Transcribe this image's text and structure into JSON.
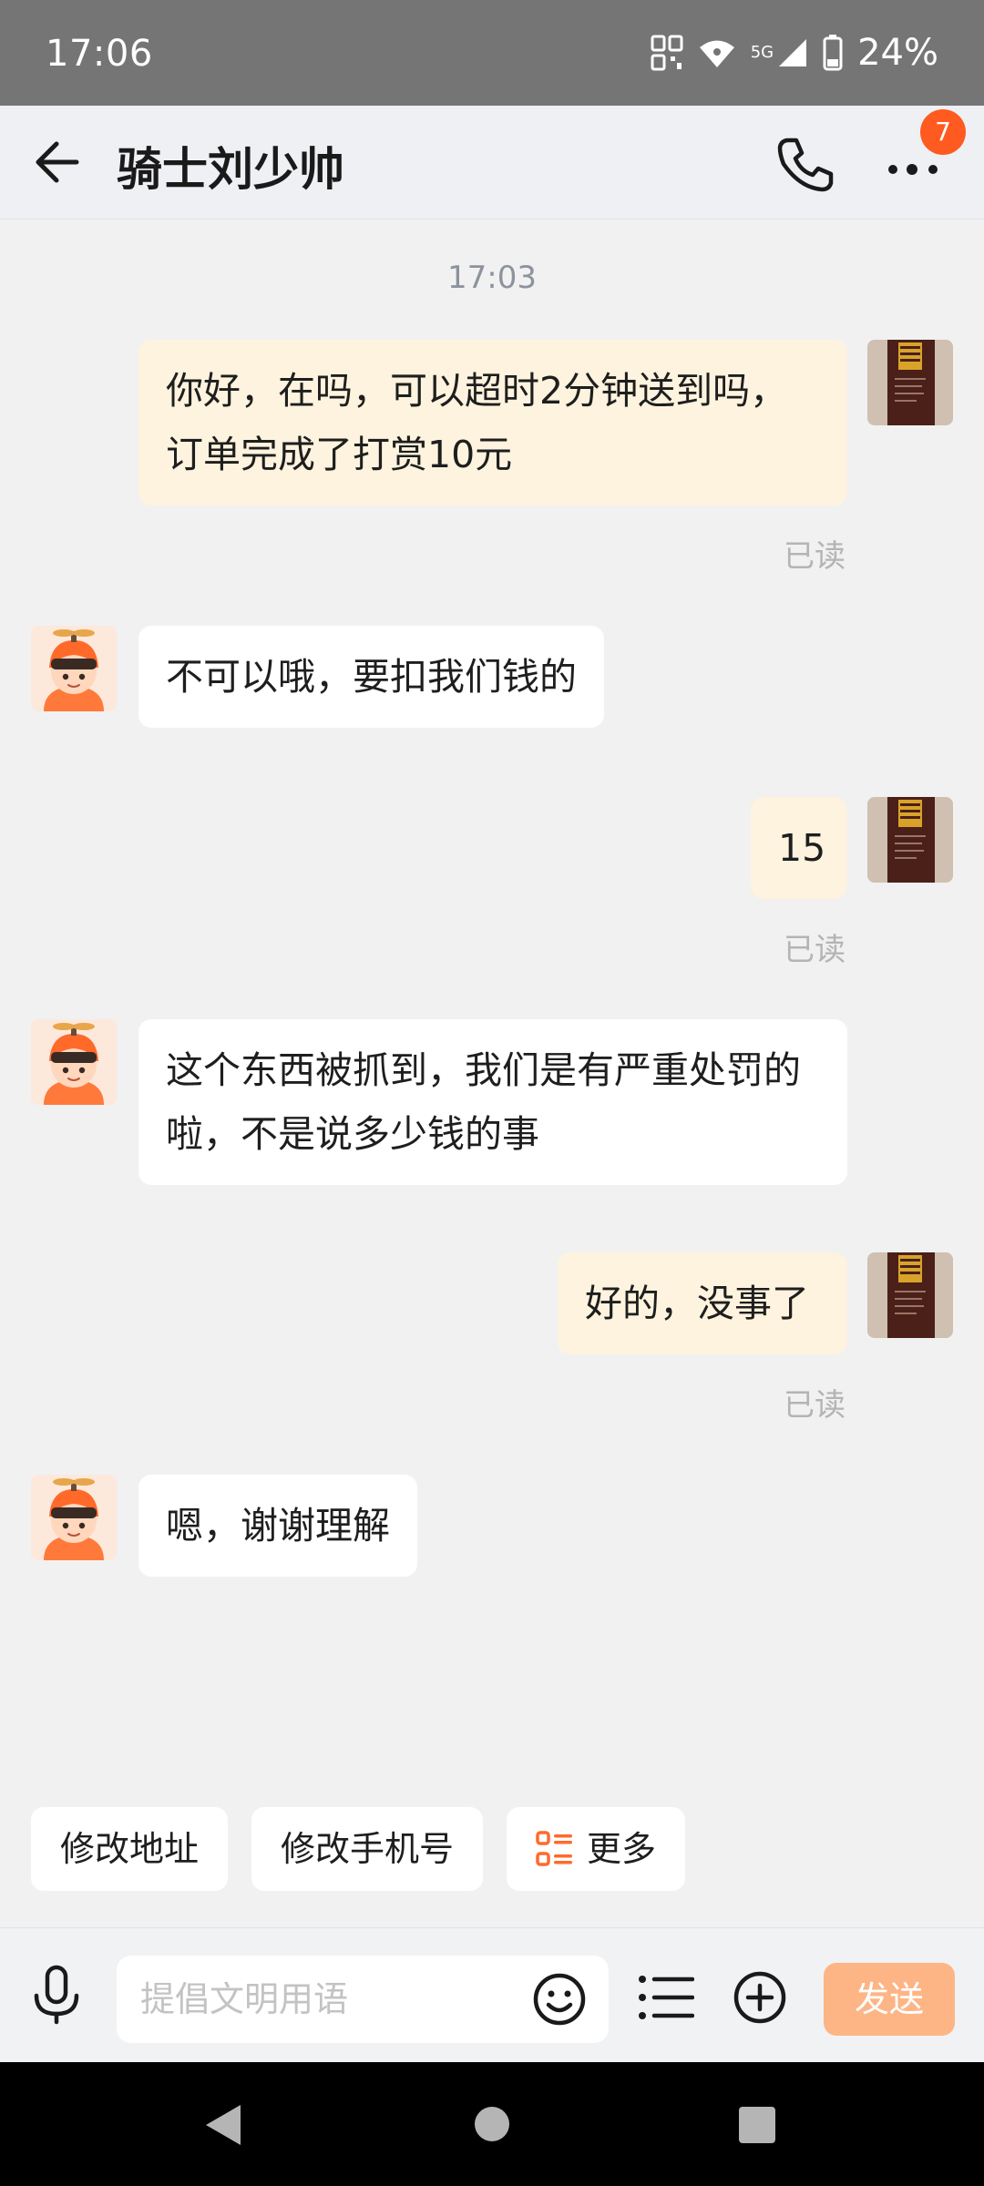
{
  "status_bar": {
    "time": "17:06",
    "network": "5G",
    "battery": "24%"
  },
  "header": {
    "title": "骑士刘少帅",
    "badge_count": "7"
  },
  "chat": {
    "timestamp": "17:03",
    "messages": [
      {
        "from": "me",
        "text": "你好，在吗，可以超时2分钟送到吗，订单完成了打赏10元",
        "status": "已读"
      },
      {
        "from": "rider",
        "text": "不可以哦，要扣我们钱的"
      },
      {
        "from": "me",
        "text": "15",
        "status": "已读"
      },
      {
        "from": "rider",
        "text": "这个东西被抓到，我们是有严重处罚的啦，不是说多少钱的事"
      },
      {
        "from": "me",
        "text": "好的，没事了",
        "status": "已读"
      },
      {
        "from": "rider",
        "text": "嗯，谢谢理解"
      }
    ]
  },
  "quick_actions": [
    {
      "label": "修改地址"
    },
    {
      "label": "修改手机号"
    },
    {
      "label": "更多",
      "icon": "list-icon"
    }
  ],
  "input": {
    "placeholder": "提倡文明用语",
    "value": "",
    "send_label": "发送"
  },
  "colors": {
    "accent": "#ff6a2b",
    "send_button": "#fdb586",
    "my_bubble": "#fdf3de",
    "rider_bubble": "#ffffff",
    "badge": "#ff5a1f"
  }
}
